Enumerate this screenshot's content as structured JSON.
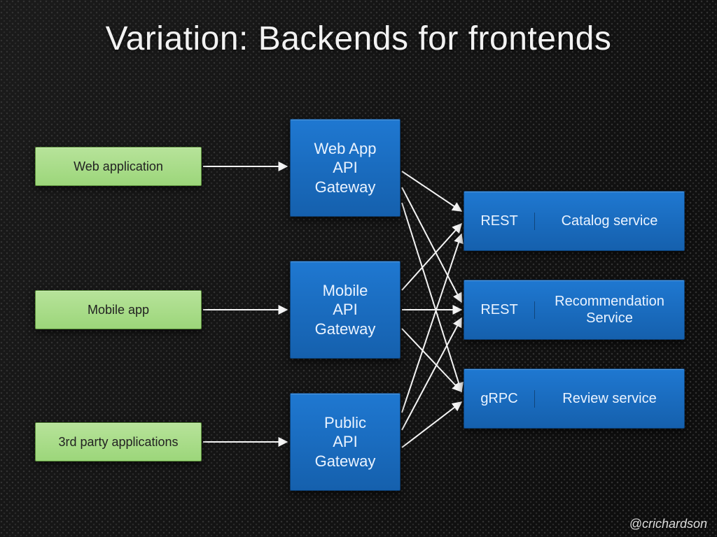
{
  "title": "Variation: Backends for frontends",
  "clients": {
    "web": "Web application",
    "mobile": "Mobile app",
    "third": "3rd party applications"
  },
  "gateways": {
    "web": "Web App\nAPI\nGateway",
    "mobile": "Mobile\nAPI\nGateway",
    "public": "Public\nAPI\nGateway"
  },
  "services": {
    "catalog": {
      "protocol": "REST",
      "name": "Catalog service"
    },
    "recommendation": {
      "protocol": "REST",
      "name": "Recommendation Service"
    },
    "review": {
      "protocol": "gRPC",
      "name": "Review service"
    }
  },
  "handle": "@crichardson"
}
